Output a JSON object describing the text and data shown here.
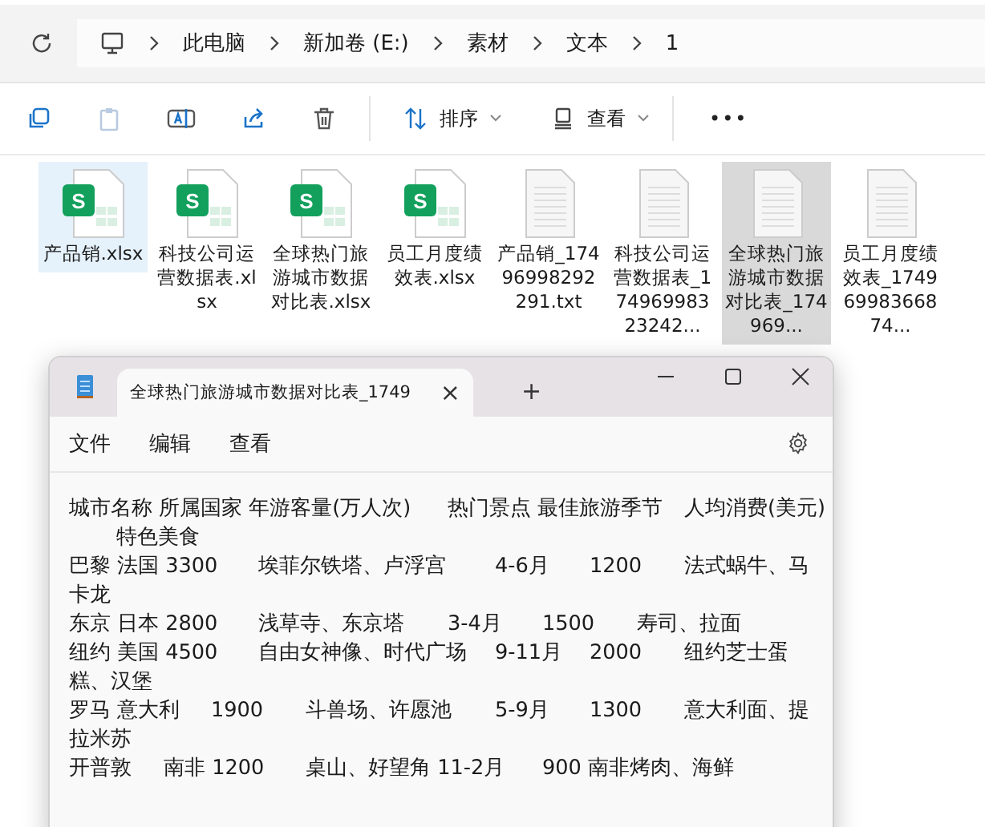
{
  "breadcrumb": [
    "此电脑",
    "新加卷 (E:)",
    "素材",
    "文本",
    "1"
  ],
  "toolbar": {
    "sort": "排序",
    "view": "查看",
    "more": "•••"
  },
  "files": [
    {
      "name": "产品销.xlsx",
      "kind": "xlsx",
      "icon_letter": "S",
      "selected": true,
      "highlighted": false
    },
    {
      "name": "科技公司运营数据表.xlsx",
      "kind": "xlsx",
      "icon_letter": "S",
      "selected": false,
      "highlighted": false
    },
    {
      "name": "全球热门旅游城市数据对比表.xlsx",
      "kind": "xlsx",
      "icon_letter": "S",
      "selected": false,
      "highlighted": false
    },
    {
      "name": "员工月度绩效表.xlsx",
      "kind": "xlsx",
      "icon_letter": "S",
      "selected": false,
      "highlighted": false
    },
    {
      "name": "产品销_17496998292291.txt",
      "kind": "txt",
      "selected": false,
      "highlighted": false
    },
    {
      "name": "科技公司运营数据表_17496998323242...",
      "kind": "txt",
      "selected": false,
      "highlighted": false
    },
    {
      "name": "全球热门旅游城市数据对比表_174969...",
      "kind": "txt",
      "selected": false,
      "highlighted": true
    },
    {
      "name": "员工月度绩效表_17496998366874...",
      "kind": "txt",
      "selected": false,
      "highlighted": false
    }
  ],
  "notepad": {
    "tab_title": "全球热门旅游城市数据对比表_1749",
    "tab_close": "×",
    "new_tab": "+",
    "menu": [
      "文件",
      "编辑",
      "查看"
    ],
    "lines": [
      "城市名称 所属国家 年游客量(万人次)\t热门景点 最佳旅游季节\t人均消费(美元)",
      "\t特色美食",
      "巴黎 法国 3300\t埃菲尔铁塔、卢浮宫\t4-6月\t1200\t法式蜗牛、马",
      "卡龙",
      "东京 日本 2800\t浅草寺、东京塔\t3-4月\t1500\t寿司、拉面",
      "纽约 美国 4500\t自由女神像、时代广场\t9-11月\t2000\t纽约芝士蛋",
      "糕、汉堡",
      "罗马 意大利\t1900\t斗兽场、许愿池\t5-9月\t1300\t意大利面、提",
      "拉米苏",
      "开普敦\t南非 1200\t桌山、好望角 11-2月\t900 南非烤肉、海鲜"
    ]
  }
}
